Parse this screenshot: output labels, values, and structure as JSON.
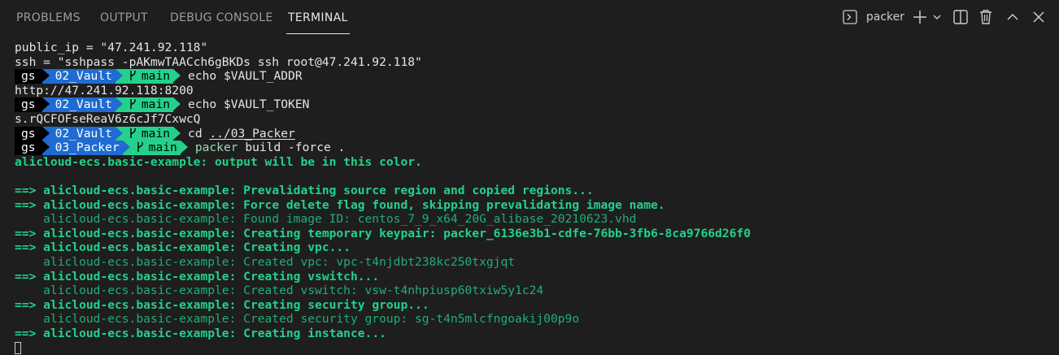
{
  "tabs": [
    {
      "label": "PROBLEMS",
      "active": false
    },
    {
      "label": "OUTPUT",
      "active": false
    },
    {
      "label": "DEBUG CONSOLE",
      "active": false
    },
    {
      "label": "TERMINAL",
      "active": true
    }
  ],
  "toolbar": {
    "terminal_name": "packer",
    "icons": [
      "terminal-icon",
      "plus-icon",
      "chevron-down-icon",
      "split-icon",
      "trash-icon",
      "chevron-up-icon",
      "close-icon"
    ]
  },
  "colors": {
    "background": "#1e1e1e",
    "green": "#23d18b",
    "prompt_blue": "#1f6bd1",
    "prompt_black": "#000000"
  },
  "terminal": {
    "lines": [
      {
        "kind": "plain",
        "text": "public_ip = \"47.241.92.118\""
      },
      {
        "kind": "plain",
        "text": "ssh = \"sshpass -pAKmwTAACch6gBKDs ssh root@47.241.92.118\""
      },
      {
        "kind": "prompt",
        "user": "gs",
        "dir": "02_Vault",
        "branch": "main",
        "cmd": "echo",
        "arg": "$VAULT_ADDR",
        "arg_underline": false
      },
      {
        "kind": "plain",
        "text": "http://47.241.92.118:8200"
      },
      {
        "kind": "prompt",
        "user": "gs",
        "dir": "02_Vault",
        "branch": "main",
        "cmd": "echo",
        "arg": "$VAULT_TOKEN",
        "arg_underline": false
      },
      {
        "kind": "plain",
        "text": "s.rQCFOFseReaV6z6cJf7CxwcQ"
      },
      {
        "kind": "prompt",
        "user": "gs",
        "dir": "02_Vault",
        "branch": "main",
        "cmd": "cd",
        "arg": "../03_Packer",
        "arg_underline": true
      },
      {
        "kind": "prompt",
        "user": "gs",
        "dir": "03_Packer",
        "branch": "main",
        "cmd": "packer",
        "arg": "build -force .",
        "arg_underline": false,
        "packer": true
      },
      {
        "kind": "greenbold",
        "text": "alicloud-ecs.basic-example: output will be in this color."
      },
      {
        "kind": "blank",
        "text": ""
      },
      {
        "kind": "step",
        "prefix": "==> ",
        "text": "alicloud-ecs.basic-example: Prevalidating source region and copied regions..."
      },
      {
        "kind": "step",
        "prefix": "==> ",
        "text": "alicloud-ecs.basic-example: Force delete flag found, skipping prevalidating image name."
      },
      {
        "kind": "detail",
        "text": "    alicloud-ecs.basic-example: Found image ID: centos_7_9_x64_20G_alibase_20210623.vhd"
      },
      {
        "kind": "step",
        "prefix": "==> ",
        "text": "alicloud-ecs.basic-example: Creating temporary keypair: packer_6136e3b1-cdfe-76bb-3fb6-8ca9766d26f0"
      },
      {
        "kind": "step",
        "prefix": "==> ",
        "text": "alicloud-ecs.basic-example: Creating vpc..."
      },
      {
        "kind": "detail",
        "text": "    alicloud-ecs.basic-example: Created vpc: vpc-t4njdbt238kc250txgjqt"
      },
      {
        "kind": "step",
        "prefix": "==> ",
        "text": "alicloud-ecs.basic-example: Creating vswitch..."
      },
      {
        "kind": "detail",
        "text": "    alicloud-ecs.basic-example: Created vswitch: vsw-t4nhpiusp60txiw5y1c24"
      },
      {
        "kind": "step",
        "prefix": "==> ",
        "text": "alicloud-ecs.basic-example: Creating security group..."
      },
      {
        "kind": "detail",
        "text": "    alicloud-ecs.basic-example: Created security group: sg-t4n5mlcfngoakij00p9o"
      },
      {
        "kind": "step",
        "prefix": "==> ",
        "text": "alicloud-ecs.basic-example: Creating instance..."
      },
      {
        "kind": "cursor",
        "text": ""
      }
    ]
  }
}
